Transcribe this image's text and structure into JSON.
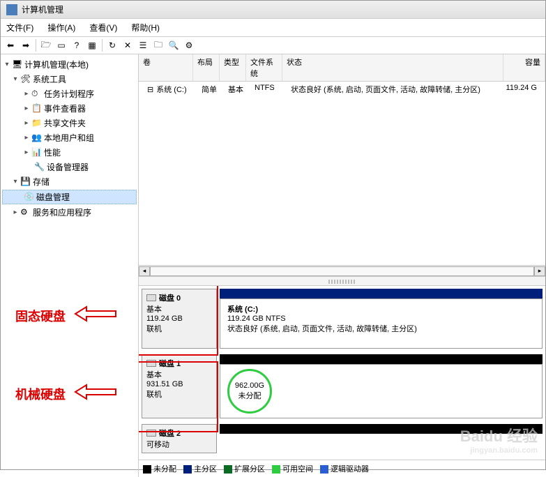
{
  "window": {
    "title": "计算机管理"
  },
  "menu": {
    "file": "文件(F)",
    "action": "操作(A)",
    "view": "查看(V)",
    "help": "帮助(H)"
  },
  "tree": {
    "root": "计算机管理(本地)",
    "sys_tools": "系统工具",
    "task_sched": "任务计划程序",
    "event_viewer": "事件查看器",
    "shared": "共享文件夹",
    "users": "本地用户和组",
    "perf": "性能",
    "devmgr": "设备管理器",
    "storage": "存储",
    "diskmgmt": "磁盘管理",
    "services": "服务和应用程序"
  },
  "volheaders": {
    "vol": "卷",
    "layout": "布局",
    "type": "类型",
    "fs": "文件系统",
    "status": "状态",
    "cap": "容量"
  },
  "volume": {
    "name": "系统 (C:)",
    "layout": "简单",
    "type": "基本",
    "fs": "NTFS",
    "status": "状态良好 (系统, 启动, 页面文件, 活动, 故障转储, 主分区)",
    "cap": "119.24 G"
  },
  "disks": [
    {
      "title": "磁盘 0",
      "kind": "基本",
      "size": "119.24 GB",
      "state": "联机",
      "part": {
        "name": "系统  (C:)",
        "size": "119.24 GB NTFS",
        "status": "状态良好 (系统, 启动, 页面文件, 活动, 故障转储, 主分区)"
      }
    },
    {
      "title": "磁盘 1",
      "kind": "基本",
      "size": "931.51 GB",
      "state": "联机",
      "unalloc": {
        "size": "962.00G",
        "label": "未分配"
      }
    },
    {
      "title": "磁盘 2",
      "kind": "可移动"
    }
  ],
  "legend": {
    "unalloc": "未分配",
    "primary": "主分区",
    "ext": "扩展分区",
    "free": "可用空间",
    "logical": "逻辑驱动器"
  },
  "annotations": {
    "ssd": "固态硬盘",
    "hdd": "机械硬盘"
  },
  "watermark": {
    "brand": "Baidu 经验",
    "url": "jingyan.baidu.com"
  },
  "colors": {
    "primary": "#001f7a",
    "unalloc": "#000000",
    "ext": "#0a6b23",
    "free": "#2ecc40",
    "logical": "#2a5fd4"
  }
}
